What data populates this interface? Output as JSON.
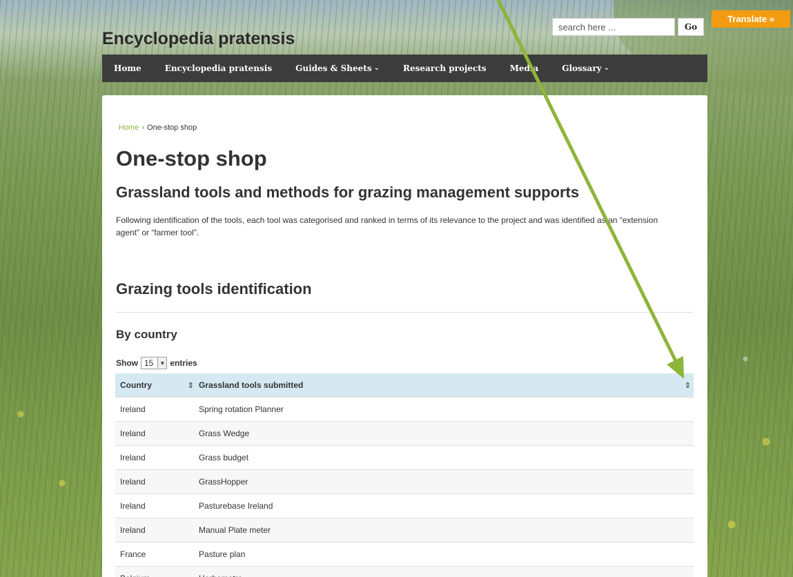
{
  "site": {
    "title": "Encyclopedia pratensis"
  },
  "search": {
    "placeholder": "search here ...",
    "go_label": "Go"
  },
  "translate": {
    "label": "Translate »"
  },
  "nav": {
    "items": [
      {
        "label": "Home"
      },
      {
        "label": "Encyclopedia pratensis"
      },
      {
        "label": "Guides & Sheets",
        "has_dropdown": true
      },
      {
        "label": "Research projects"
      },
      {
        "label": "Media"
      },
      {
        "label": "Glossary",
        "has_dropdown": true
      }
    ],
    "dropdown_glyph": "⌄"
  },
  "breadcrumb": {
    "home": "Home",
    "separator": "›",
    "current": "One-stop shop"
  },
  "page": {
    "title": "One-stop shop",
    "subtitle": "Grassland tools and methods for grazing management supports",
    "intro": "Following identification of the tools, each tool was categorised and ranked in terms of its relevance to the project and was identified as an “extension agent” or “farmer tool”.",
    "section_title": "Grazing tools identification",
    "subsection_title": "By country"
  },
  "table_controls": {
    "show_label": "Show",
    "entries_value": "15",
    "entries_label": "entries"
  },
  "table": {
    "headers": [
      "Country",
      "Grassland tools submitted"
    ],
    "sort_glyph": "⇕",
    "rows": [
      [
        "Ireland",
        "Spring rotation Planner"
      ],
      [
        "Ireland",
        "Grass Wedge"
      ],
      [
        "Ireland",
        "Grass budget"
      ],
      [
        "Ireland",
        "GrassHopper"
      ],
      [
        "Ireland",
        "Pasturebase Ireland"
      ],
      [
        "Ireland",
        "Manual Plate meter"
      ],
      [
        "France",
        "Pasture plan"
      ],
      [
        "Belgium",
        "Herbometre"
      ]
    ]
  },
  "colors": {
    "nav_bg": "#3c3c3c",
    "translate_bg": "#f39c12",
    "link_green": "#8fb73e",
    "table_header_bg": "#d6e9f2",
    "annotation_arrow": "#8db53a"
  }
}
